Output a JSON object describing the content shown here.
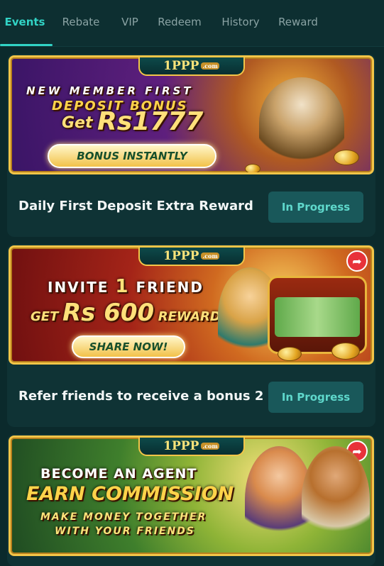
{
  "tabs": [
    "Events",
    "Rebate",
    "VIP",
    "Redeem",
    "History",
    "Reward"
  ],
  "brand": {
    "logo": "1PPP",
    "logo_suffix": ".com"
  },
  "events": [
    {
      "banner": {
        "line1": "NEW MEMBER FIRST",
        "line2": "DEPOSIT BONUS",
        "line3_prefix": "Get",
        "line3_amount": "Rs1777",
        "button": "BONUS INSTANTLY"
      },
      "title": "Daily First Deposit Extra Reward",
      "status": "In Progress"
    },
    {
      "banner": {
        "line1_a": "INVITE",
        "line1_num": "1",
        "line1_b": "FRIEND",
        "line2_a": "GET",
        "line2_amount": "Rs 600",
        "line2_b": "REWARD",
        "button": "SHARE NOW!"
      },
      "title": "Refer friends to receive a bonus 2",
      "status": "In Progress"
    },
    {
      "banner": {
        "line1": "BECOME AN AGENT",
        "line2": "EARN COMMISSION",
        "line3": "MAKE MONEY TOGETHER",
        "line4": "WITH YOUR FRIENDS"
      }
    }
  ],
  "icons": [
    "share-icon"
  ]
}
